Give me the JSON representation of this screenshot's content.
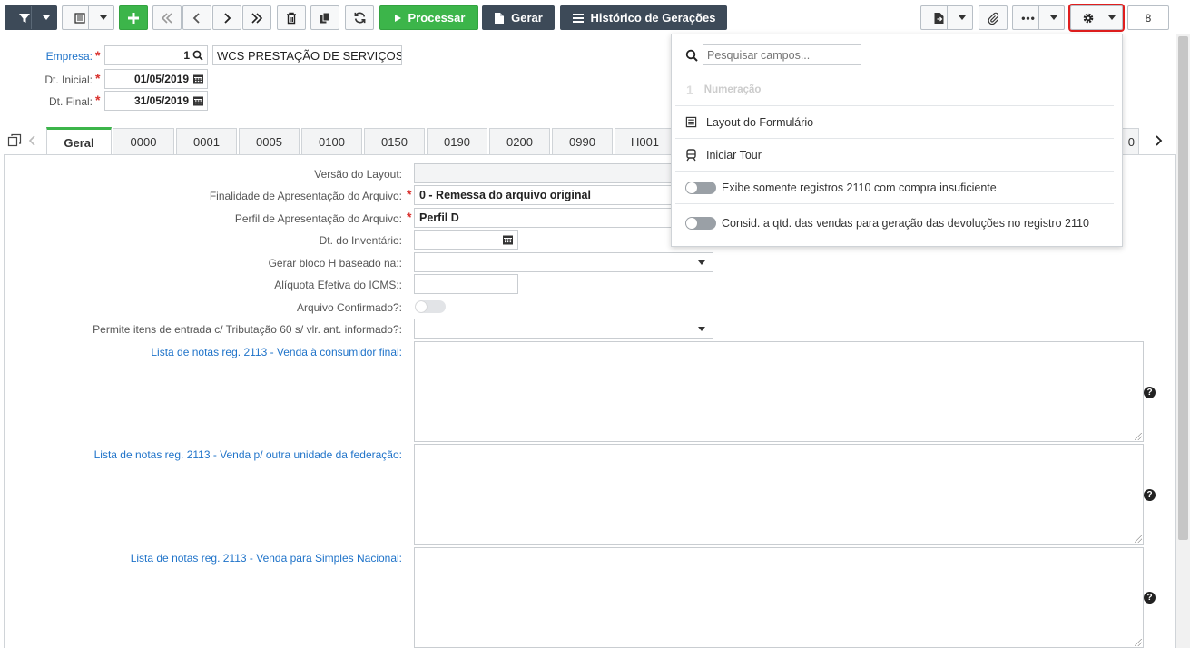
{
  "toolbar": {
    "processar_label": "Processar",
    "gerar_label": "Gerar",
    "historico_label": "Histórico de Gerações",
    "page_count": "8"
  },
  "header": {
    "empresa_label": "Empresa:",
    "empresa_code": "1",
    "empresa_name": "WCS PRESTAÇÃO DE SERVIÇOS",
    "dt_inicial_label": "Dt. Inicial:",
    "dt_inicial": "01/05/2019",
    "dt_final_label": "Dt. Final:",
    "dt_final": "31/05/2019"
  },
  "tabs": [
    "Geral",
    "0000",
    "0001",
    "0005",
    "0100",
    "0150",
    "0190",
    "0200",
    "0990",
    "H001",
    "0"
  ],
  "form": {
    "versao_label": "Versão do Layout:",
    "finalidade_label": "Finalidade de Apresentação do Arquivo:",
    "finalidade_value": "0 - Remessa do arquivo original",
    "perfil_label": "Perfil de Apresentação do Arquivo:",
    "perfil_value": "Perfil D",
    "dt_inventario_label": "Dt. do Inventário:",
    "bloco_h_label": "Gerar bloco H baseado na::",
    "aliquota_label": "Alíquota Efetiva do ICMS::",
    "arquivo_label": "Arquivo Confirmado?:",
    "permite_label": "Permite itens de entrada c/ Tributação 60 s/ vlr. ant. informado?:",
    "lista1_label": "Lista de notas reg. 2113 - Venda à consumidor final:",
    "lista2_label": "Lista de notas reg. 2113 - Venda p/ outra unidade da federação:",
    "lista3_label": "Lista de notas reg. 2113 - Venda para Simples Nacional:",
    "help_glyph": "?"
  },
  "dropdown": {
    "search_placeholder": "Pesquisar campos...",
    "numeracao_num": "1",
    "numeracao_label": "Numeração",
    "layout_label": "Layout do Formulário",
    "tour_label": "Iniciar Tour",
    "toggle1_label": "Exibe somente registros 2110 com compra insuficiente",
    "toggle2_label": "Consid. a qtd. das vendas para geração das devoluções no registro 2110"
  },
  "colors": {
    "accent_green": "#3cb54a",
    "dark_button": "#3d4a58",
    "link_blue": "#1f73c9",
    "required_red": "#d9302c",
    "highlight_red": "#e01e1e"
  }
}
